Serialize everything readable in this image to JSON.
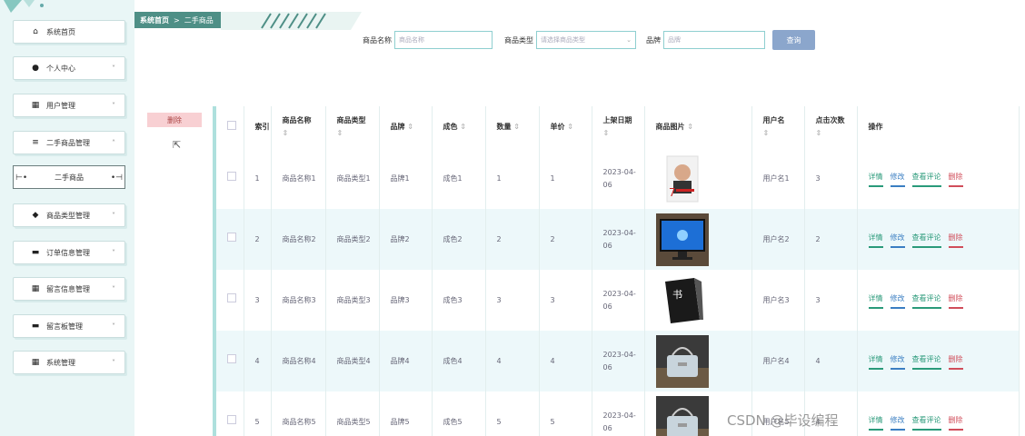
{
  "sidebar": {
    "items": [
      {
        "label": "系统首页",
        "icon": "home-icon",
        "glyph": "⌂",
        "chevron": false
      },
      {
        "label": "个人中心",
        "icon": "user-icon",
        "glyph": "●",
        "chevron": true
      },
      {
        "label": "用户管理",
        "icon": "grid-icon",
        "glyph": "▦",
        "chevron": true
      },
      {
        "label": "二手商品管理",
        "icon": "list-icon",
        "glyph": "≡",
        "chevron": true,
        "expanded": true
      },
      {
        "label": "商品类型管理",
        "icon": "tag-icon",
        "glyph": "◆",
        "chevron": true
      },
      {
        "label": "订单信息管理",
        "icon": "card-icon",
        "glyph": "▬",
        "chevron": true
      },
      {
        "label": "留言信息管理",
        "icon": "grid-icon",
        "glyph": "▦",
        "chevron": true
      },
      {
        "label": "留言板管理",
        "icon": "board-icon",
        "glyph": "▬",
        "chevron": true
      },
      {
        "label": "系统管理",
        "icon": "grid-icon",
        "glyph": "▦",
        "chevron": true
      }
    ],
    "sub_item": "二手商品"
  },
  "breadcrumb": {
    "home": "系统首页",
    "sep": ">",
    "current": "二手商品"
  },
  "search": {
    "name_label": "商品名称",
    "name_placeholder": "商品名称",
    "type_label": "商品类型",
    "type_placeholder": "请选择商品类型",
    "brand_label": "品牌",
    "brand_placeholder": "品牌",
    "query_button": "查询"
  },
  "delete_button": "删除",
  "table": {
    "headers": [
      "索引",
      "商品名称",
      "商品类型",
      "品牌",
      "成色",
      "数量",
      "单价",
      "上架日期",
      "商品图片",
      "用户名",
      "点击次数",
      "操作"
    ],
    "sort_mark": "⇕",
    "rows": [
      {
        "index": "1",
        "name": "商品名称1",
        "type": "商品类型1",
        "brand": "品牌1",
        "condition": "成色1",
        "qty": "1",
        "price": "1",
        "date": "2023-04-06",
        "image": "book-cover-image",
        "user": "用户名1",
        "clicks": "3"
      },
      {
        "index": "2",
        "name": "商品名称2",
        "type": "商品类型2",
        "brand": "品牌2",
        "condition": "成色2",
        "qty": "2",
        "price": "2",
        "date": "2023-04-06",
        "image": "monitor-image",
        "user": "用户名2",
        "clicks": "2"
      },
      {
        "index": "3",
        "name": "商品名称3",
        "type": "商品类型3",
        "brand": "品牌3",
        "condition": "成色3",
        "qty": "3",
        "price": "3",
        "date": "2023-04-06",
        "image": "black-book-image",
        "user": "用户名3",
        "clicks": "3"
      },
      {
        "index": "4",
        "name": "商品名称4",
        "type": "商品类型4",
        "brand": "品牌4",
        "condition": "成色4",
        "qty": "4",
        "price": "4",
        "date": "2023-04-06",
        "image": "handbag-image",
        "user": "用户名4",
        "clicks": "4"
      },
      {
        "index": "5",
        "name": "商品名称5",
        "type": "商品类型5",
        "brand": "品牌5",
        "condition": "成色5",
        "qty": "5",
        "price": "5",
        "date": "2023-04-06",
        "image": "handbag-image",
        "user": "用户名5",
        "clicks": "4"
      }
    ],
    "ops": {
      "detail": "详情",
      "edit": "修改",
      "review": "查看评论",
      "delete": "删除"
    }
  },
  "watermark": "CSDN @毕设编程"
}
